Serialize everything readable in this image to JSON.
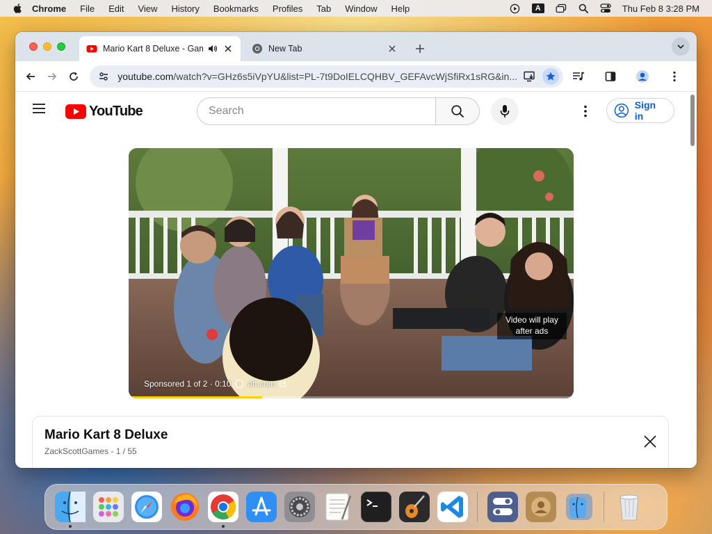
{
  "menubar": {
    "app": "Chrome",
    "items": [
      "File",
      "Edit",
      "View",
      "History",
      "Bookmarks",
      "Profiles",
      "Tab",
      "Window",
      "Help"
    ],
    "clock": "Thu Feb 8  3:28 PM",
    "input_source": "A"
  },
  "browser": {
    "tabs": [
      {
        "title": "Mario Kart 8 Deluxe - Gam",
        "favicon": "youtube-icon",
        "audio": true,
        "active": true
      },
      {
        "title": "New Tab",
        "favicon": "chrome-icon",
        "audio": false,
        "active": false
      }
    ],
    "url_host": "youtube.com",
    "url_path": "/watch?v=GHz6s5iVpYU&list=PL-7t9DoIELCQHBV_GEFAvcWjSfiRx1sRG&in..."
  },
  "youtube": {
    "logo_text": "YouTube",
    "search_placeholder": "Search",
    "sign_in": "Sign in",
    "ad": {
      "sponsored": "Sponsored 1 of 2 · 0:10",
      "advertiser": "att.com",
      "overlay": "Video will play after ads",
      "progress": 0.3
    },
    "playlist": {
      "title": "Mario Kart 8 Deluxe",
      "subtitle": "ZackScottGames - 1 / 55"
    }
  },
  "dock": {
    "apps": [
      {
        "name": "finder",
        "running": true
      },
      {
        "name": "launchpad",
        "running": false
      },
      {
        "name": "safari",
        "running": false
      },
      {
        "name": "firefox",
        "running": false
      },
      {
        "name": "chrome",
        "running": true
      },
      {
        "name": "app-store",
        "running": false
      },
      {
        "name": "system-settings",
        "running": false
      },
      {
        "name": "textedit",
        "running": false
      },
      {
        "name": "terminal",
        "running": false
      },
      {
        "name": "garageband",
        "running": false
      },
      {
        "name": "vscode",
        "running": false
      },
      {
        "name": "control-panel",
        "running": false
      },
      {
        "name": "contacts",
        "running": false
      },
      {
        "name": "migration-assistant",
        "running": false
      },
      {
        "name": "trash",
        "running": false
      }
    ]
  },
  "colors": {
    "youtube_red": "#ff0000",
    "link_blue": "#065fd4",
    "ad_progress": "#ffcc00"
  }
}
